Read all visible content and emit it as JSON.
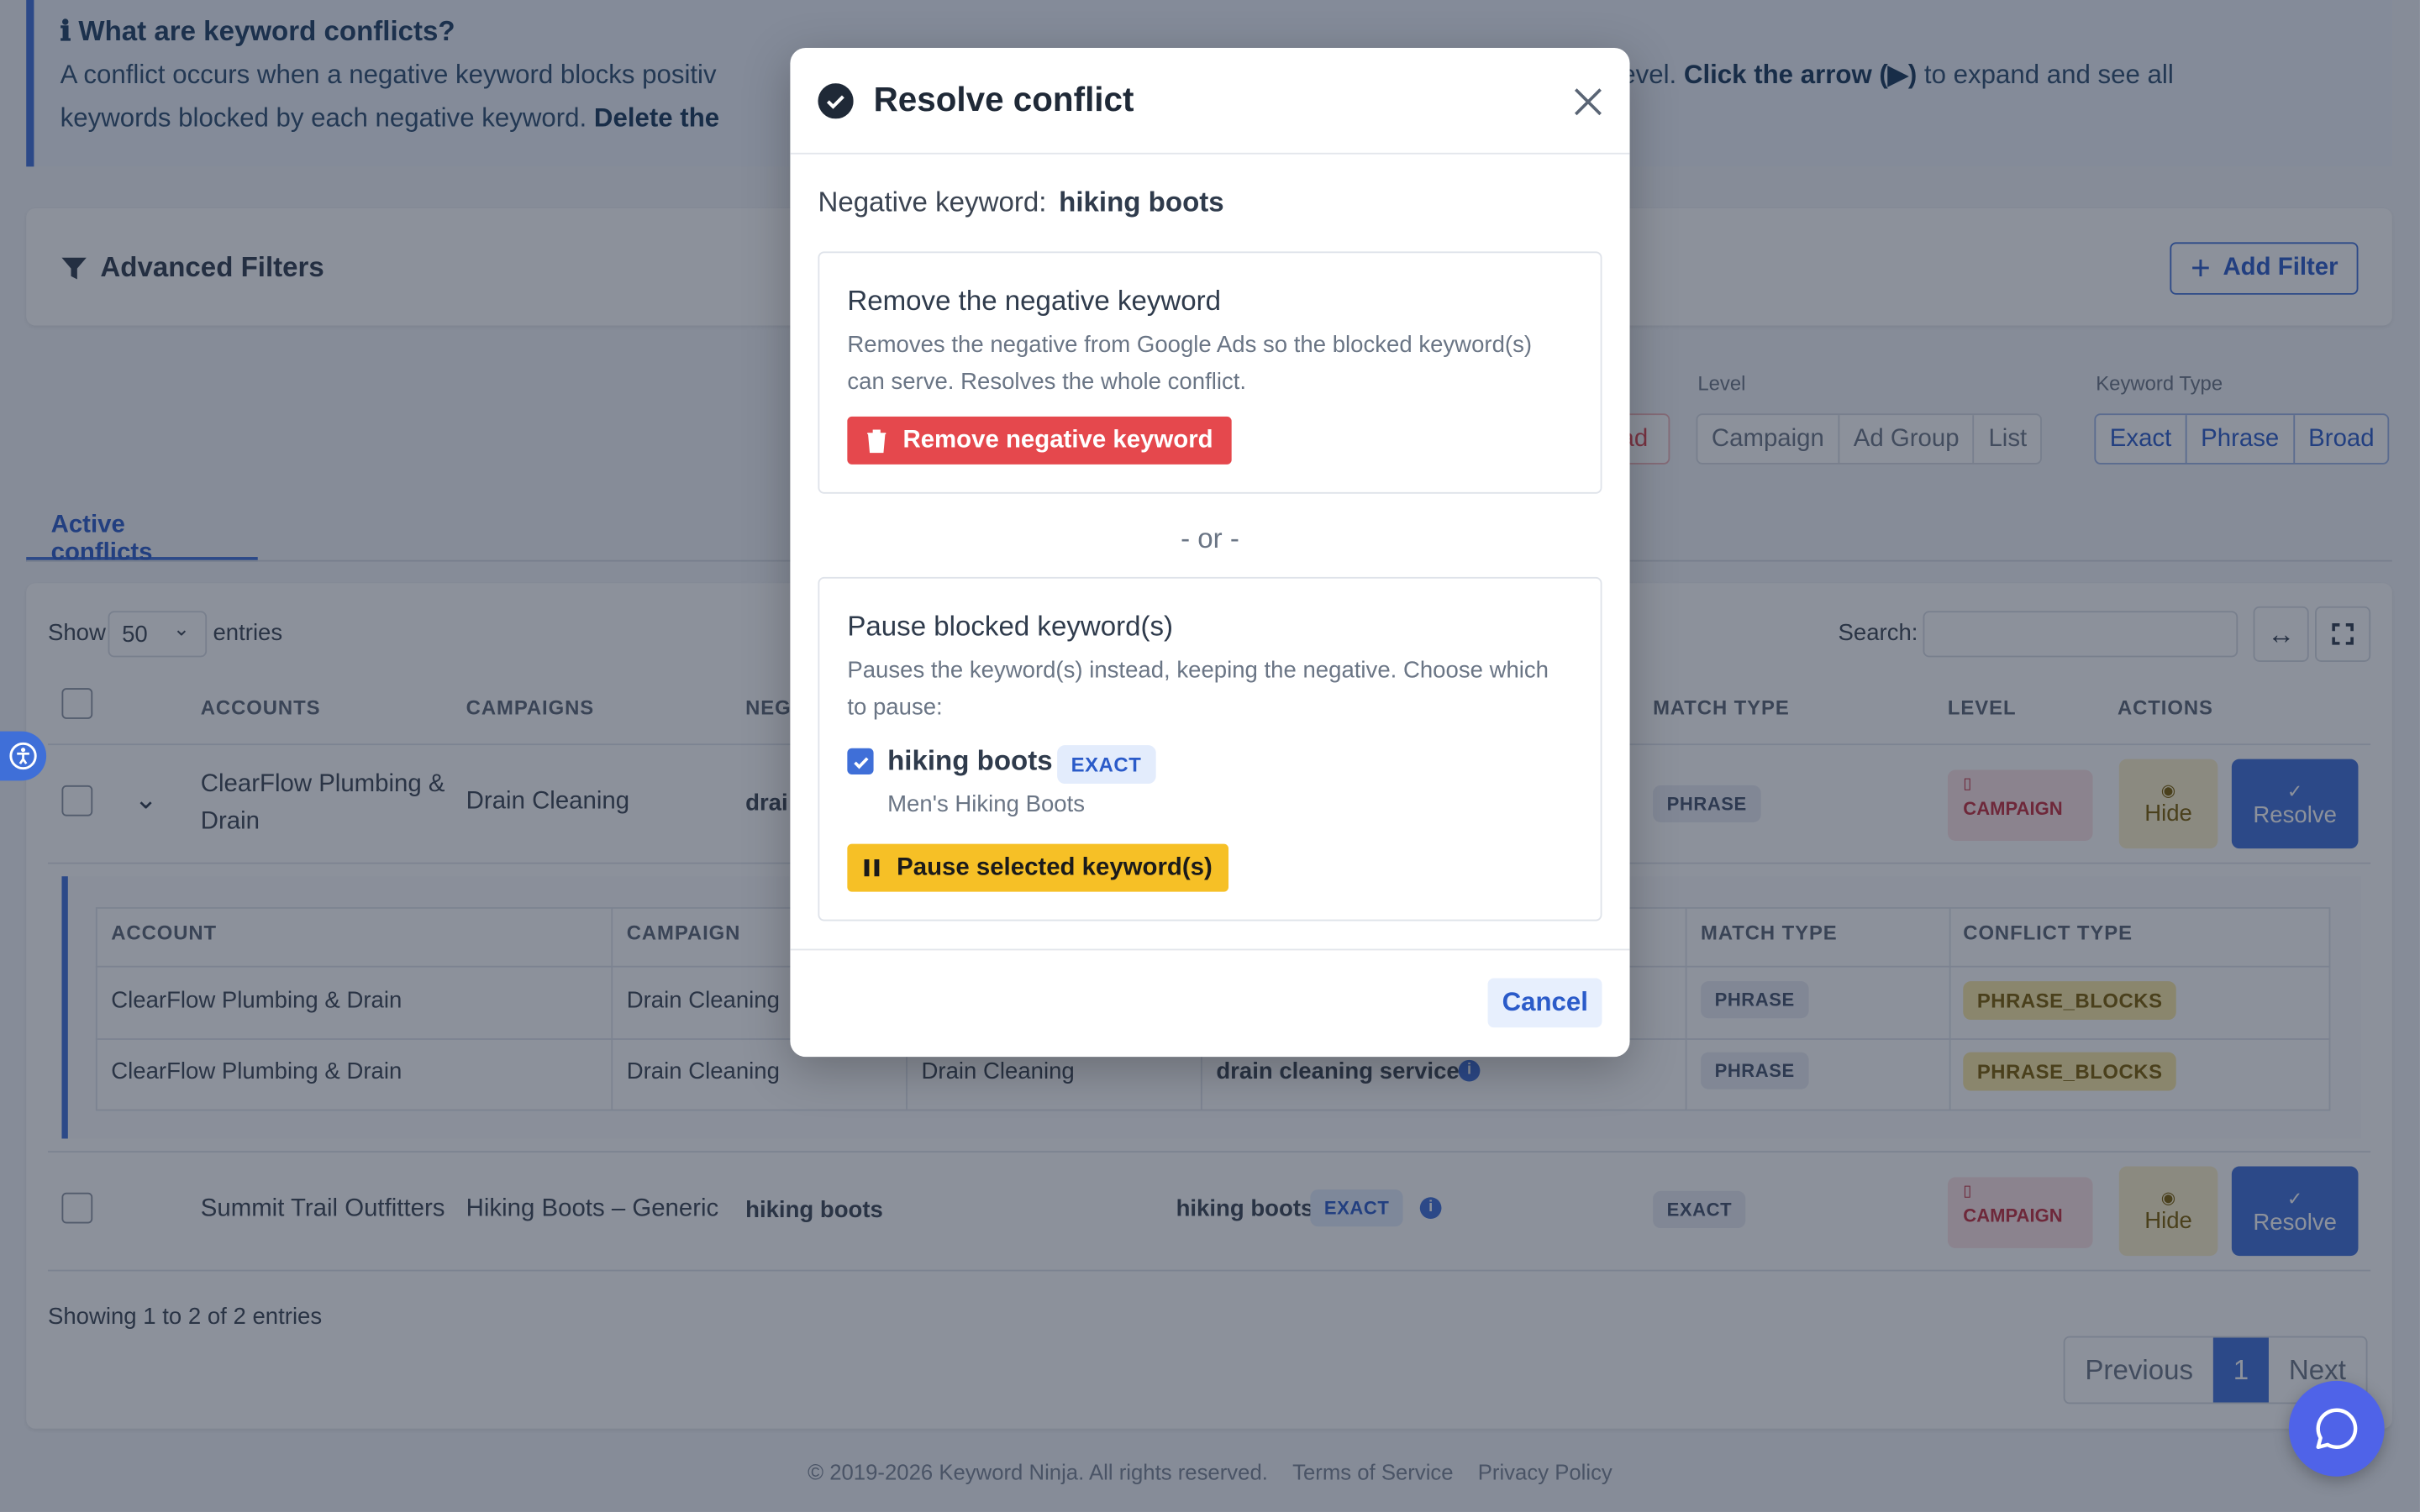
{
  "info": {
    "title": "ℹ What are keyword conflicts?",
    "text1": "A conflict occurs when a negative keyword blocks positiv",
    "text2": "d group level.",
    "bold1": "Click the arrow (▶)",
    "text3": "to expand and see all",
    "line2": "keywords blocked by each negative keyword.",
    "bold2": "Delete the"
  },
  "filters": {
    "title": "Advanced Filters",
    "add_label": "Add Filter",
    "partial_label": "ad",
    "level_label": "Level",
    "level_options": [
      "Campaign",
      "Ad Group",
      " List"
    ],
    "type_label": "Keyword Type",
    "type_options": [
      "Exact",
      "Phrase",
      "Broad"
    ]
  },
  "tabs": {
    "active": "Active conflicts"
  },
  "table": {
    "show_label": "Show",
    "show_value": "50",
    "entries_label": "entries",
    "search_label": "Search:",
    "headers": {
      "accounts": "ACCOUNTS",
      "campaigns": "CAMPAIGNS",
      "neg": "NEG",
      "match": "MATCH TYPE",
      "level": "LEVEL",
      "actions": "ACTIONS"
    },
    "rows": [
      {
        "account": "ClearFlow Plumbing & Drain",
        "campaign": "Drain Cleaning",
        "neg": "drai",
        "match": "PHRASE",
        "level": "CAMPAIGN",
        "hide": "Hide",
        "resolve": "Resolve"
      },
      {
        "account": "Summit Trail Outfitters",
        "campaign": "Hiking Boots – Generic",
        "neg": "hiking boots",
        "kw": "hiking boots",
        "kw_badge": "EXACT",
        "match": "EXACT",
        "level": "CAMPAIGN",
        "hide": "Hide",
        "resolve": "Resolve"
      }
    ],
    "sub": {
      "headers": {
        "account": "ACCOUNT",
        "campaign": "CAMPAIGN",
        "match": "MATCH TYPE",
        "conflict": "CONFLICT TYPE"
      },
      "rows": [
        {
          "account": "ClearFlow Plumbing & Drain",
          "campaign": "Drain Cleaning",
          "adgroup": "",
          "kw": "",
          "match": "PHRASE",
          "conflict": "PHRASE_BLOCKS"
        },
        {
          "account": "ClearFlow Plumbing & Drain",
          "campaign": "Drain Cleaning",
          "adgroup": "Drain Cleaning",
          "kw": "drain cleaning service",
          "match": "PHRASE",
          "conflict": "PHRASE_BLOCKS"
        }
      ]
    },
    "summary": "Showing 1 to 2 of 2 entries",
    "pager": {
      "prev": "Previous",
      "page": "1",
      "next": "Next"
    }
  },
  "footer": {
    "copy": "© 2019-2026 Keyword Ninja. All rights reserved.",
    "terms": "Terms of Service",
    "privacy": "Privacy Policy"
  },
  "modal": {
    "title": "Resolve conflict",
    "neg_label": "Negative keyword:",
    "neg_value": "hiking boots",
    "remove": {
      "title": "Remove the negative keyword",
      "desc": "Removes the negative from Google Ads so the blocked keyword(s) can serve. Resolves the whole conflict.",
      "button": "Remove negative keyword"
    },
    "or": "- or -",
    "pause": {
      "title": "Pause blocked keyword(s)",
      "desc": "Pauses the keyword(s) instead, keeping the negative. Choose which to pause:",
      "kw": "hiking boots",
      "kw_badge": "EXACT",
      "kw_adgroup": "Men's Hiking Boots",
      "checked": true,
      "button": "Pause selected keyword(s)"
    },
    "cancel": "Cancel"
  },
  "colors": {
    "primary": "#3f6fd8",
    "danger": "#e5484d",
    "warning": "#f6c026"
  }
}
